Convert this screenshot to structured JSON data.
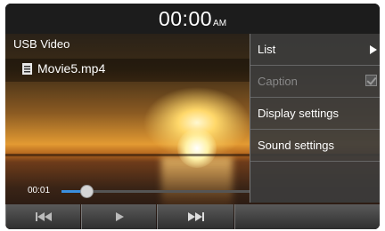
{
  "status_bar": {
    "time": "00:00",
    "ampm": "AM"
  },
  "source": {
    "title": "USB Video"
  },
  "file": {
    "name": "Movie5.mp4",
    "icon": "list-icon"
  },
  "playback": {
    "elapsed": "00:01",
    "progress_fraction": 0.13
  },
  "controls": [
    {
      "name": "previous-icon"
    },
    {
      "name": "play-icon"
    },
    {
      "name": "next-icon"
    }
  ],
  "menu": {
    "items": [
      {
        "label": "List",
        "enabled": true
      },
      {
        "label": "Caption",
        "enabled": false
      },
      {
        "label": "Display settings",
        "enabled": true
      },
      {
        "label": "Sound settings",
        "enabled": true
      }
    ]
  },
  "colors": {
    "accent": "#3a8fe0",
    "menu_bg": "#3c3c3c",
    "disabled_text": "#888888"
  }
}
